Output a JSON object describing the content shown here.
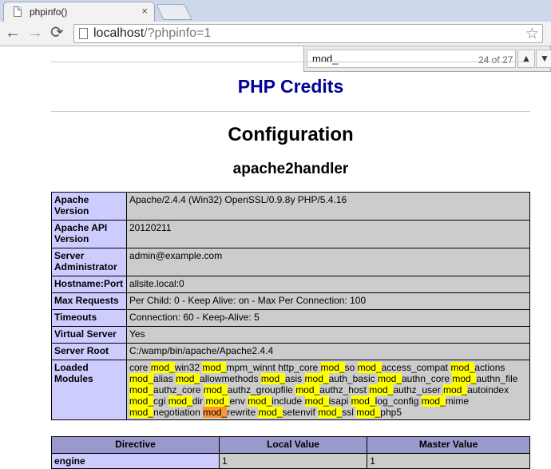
{
  "browser": {
    "tab_title": "phpinfo()",
    "tab_close": "×",
    "url_host": "localhost",
    "url_path": "/?phpinfo=1",
    "back": "←",
    "forward": "→",
    "reload": "⟳",
    "star": "☆"
  },
  "find": {
    "query": "mod_",
    "count": "24 of 27",
    "prev": "▲",
    "next": "▼"
  },
  "page": {
    "credits": "PHP Credits",
    "configuration": "Configuration",
    "module": "apache2handler"
  },
  "info_rows": [
    {
      "key": "Apache Version",
      "value": "Apache/2.4.4 (Win32) OpenSSL/0.9.8y PHP/5.4.16"
    },
    {
      "key": "Apache API Version",
      "value": "20120211"
    },
    {
      "key": "Server Administrator",
      "value": "admin@example.com"
    },
    {
      "key": "Hostname:Port",
      "value": "allsite.local:0"
    },
    {
      "key": "Max Requests",
      "value": "Per Child: 0 - Keep Alive: on - Max Per Connection: 100"
    },
    {
      "key": "Timeouts",
      "value": "Connection: 60 - Keep-Alive: 5"
    },
    {
      "key": "Virtual Server",
      "value": "Yes"
    },
    {
      "key": "Server Root",
      "value": "C:/wamp/bin/apache/Apache2.4.4"
    }
  ],
  "loaded_modules": {
    "key": "Loaded Modules",
    "prefix_first": "core ",
    "items": [
      "win32",
      "mpm_winnt http_core",
      "so",
      "access_compat",
      "actions",
      "alias",
      "allowmethods",
      "asis",
      "auth_basic",
      "authn_core",
      "authn_file",
      "authz_core",
      "authz_groupfile",
      "authz_host",
      "authz_user",
      "autoindex",
      "cgi",
      "dir",
      "env",
      "include",
      "isapi",
      "log_config",
      "mime",
      "negotiation",
      "rewrite",
      "setenvif",
      "ssl",
      "php5"
    ],
    "active_index": 24
  },
  "directive_table": {
    "headers": [
      "Directive",
      "Local Value",
      "Master Value"
    ],
    "rows": [
      {
        "directive": "engine",
        "local": "1",
        "master": "1"
      }
    ]
  }
}
